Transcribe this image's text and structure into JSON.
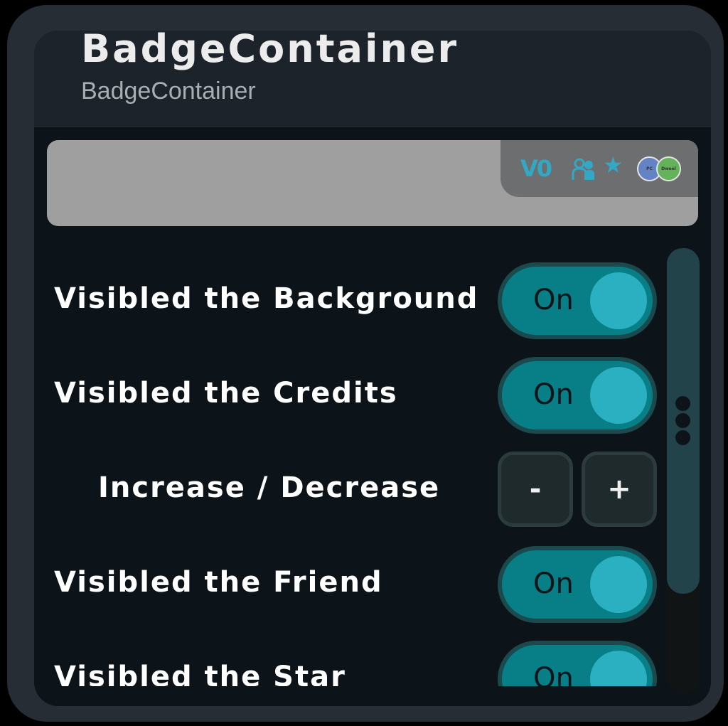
{
  "header": {
    "title": "BadgeContainer",
    "subtitle": "BadgeContainer"
  },
  "badge": {
    "credits": "V0",
    "friend_icon": "friend-icon",
    "star_icon": "star-icon",
    "avatars": [
      {
        "label": "PC"
      },
      {
        "label": "Dweel"
      }
    ],
    "accent_color": "#32a8c4"
  },
  "settings": {
    "background": {
      "label": "Visibled the Background",
      "state": "On"
    },
    "credits": {
      "label": "Visibled the Credits",
      "state": "On"
    },
    "stepper": {
      "label": "Increase / Decrease",
      "decrease": "-",
      "increase": "+"
    },
    "friend": {
      "label": "Visibled the Friend",
      "state": "On"
    },
    "star": {
      "label": "Visibled the Star",
      "state": "On"
    }
  },
  "colors": {
    "toggle_on": "#087f86",
    "knob": "#2ab0c0",
    "panel": "#0d1419"
  },
  "scrollbar": {
    "handle_icon": "drag-handle-icon"
  }
}
